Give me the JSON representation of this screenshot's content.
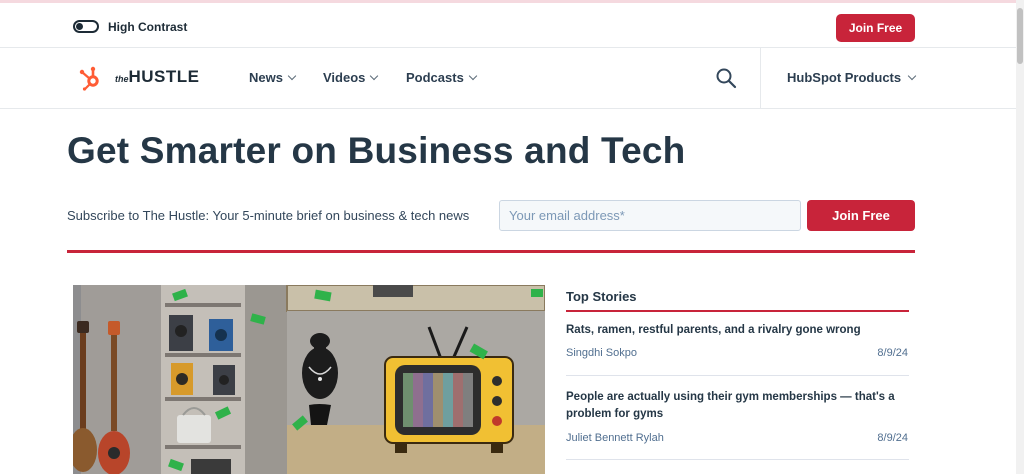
{
  "utility_bar": {
    "high_contrast_label": "High Contrast",
    "join_label": "Join Free"
  },
  "nav": {
    "logo_the": "the",
    "logo_name": "HUSTLE",
    "items": [
      {
        "label": "News"
      },
      {
        "label": "Videos"
      },
      {
        "label": "Podcasts"
      }
    ],
    "search_icon": "search-icon",
    "hubspot_products_label": "HubSpot Products"
  },
  "hero": {
    "title": "Get Smarter on Business and Tech",
    "subscribe_text": "Subscribe to The Hustle: Your 5-minute brief on business & tech news",
    "email_placeholder": "Your email address*",
    "join_label": "Join Free"
  },
  "top_stories": {
    "heading": "Top Stories",
    "stories": [
      {
        "title": "Rats, ramen, restful parents, and a rivalry gone wrong",
        "author": "Singdhi Sokpo",
        "date": "8/9/24"
      },
      {
        "title": "People are actually using their gym memberships — that's a problem for gyms",
        "author": "Juliet Bennett Rylah",
        "date": "8/9/24"
      }
    ]
  },
  "colors": {
    "brand_red": "#c8243a",
    "hubspot_orange": "#ff5c35",
    "text_dark": "#253746"
  }
}
